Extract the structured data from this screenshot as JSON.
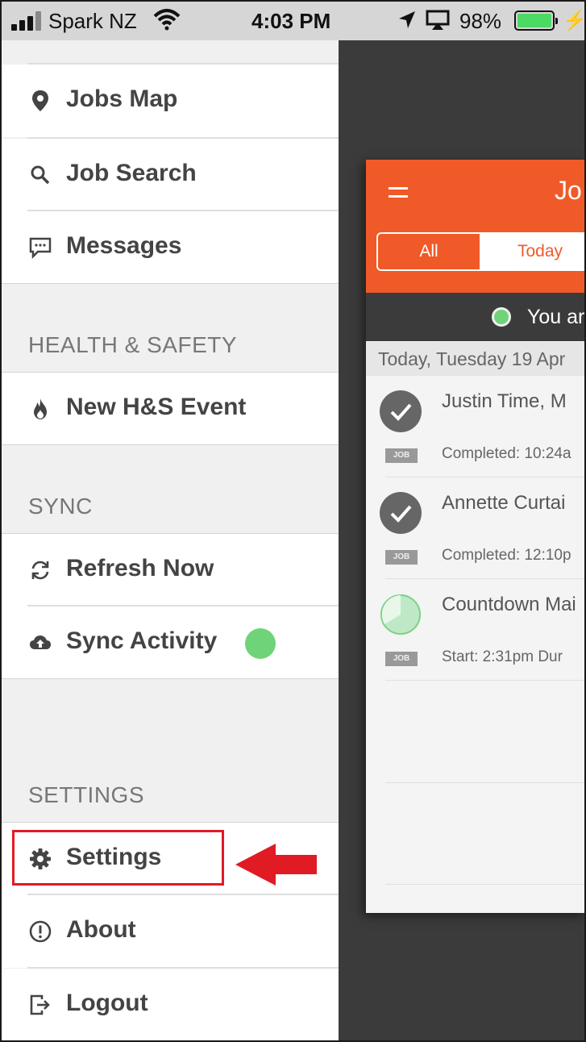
{
  "status_bar": {
    "carrier": "Spark NZ",
    "time": "4:03 PM",
    "battery": "98%"
  },
  "menu": {
    "jobs_map": "Jobs Map",
    "job_search": "Job Search",
    "messages": "Messages",
    "health_safety_header": "HEALTH & SAFETY",
    "new_hs_event": "New H&S Event",
    "sync_header": "SYNC",
    "refresh_now": "Refresh Now",
    "sync_activity": "Sync Activity",
    "settings_header": "SETTINGS",
    "settings": "Settings",
    "about": "About",
    "logout": "Logout"
  },
  "preview": {
    "title": "Jo",
    "tab_all": "All",
    "tab_today": "Today",
    "online_text": "You ar",
    "date_header": "Today, Tuesday 19 Apr",
    "jobs": [
      {
        "name": "Justin Time, M",
        "badge": "JOB",
        "status": "Completed: 10:24a"
      },
      {
        "name": "Annette Curtai",
        "badge": "JOB",
        "status": "Completed: 12:10p"
      },
      {
        "name": "Countdown Mai",
        "badge": "JOB",
        "status": "Start: 2:31pm  Dur"
      }
    ]
  },
  "colors": {
    "brand_orange": "#f05a28",
    "online_green": "#6fd37a",
    "highlight_red": "#e01b24"
  }
}
